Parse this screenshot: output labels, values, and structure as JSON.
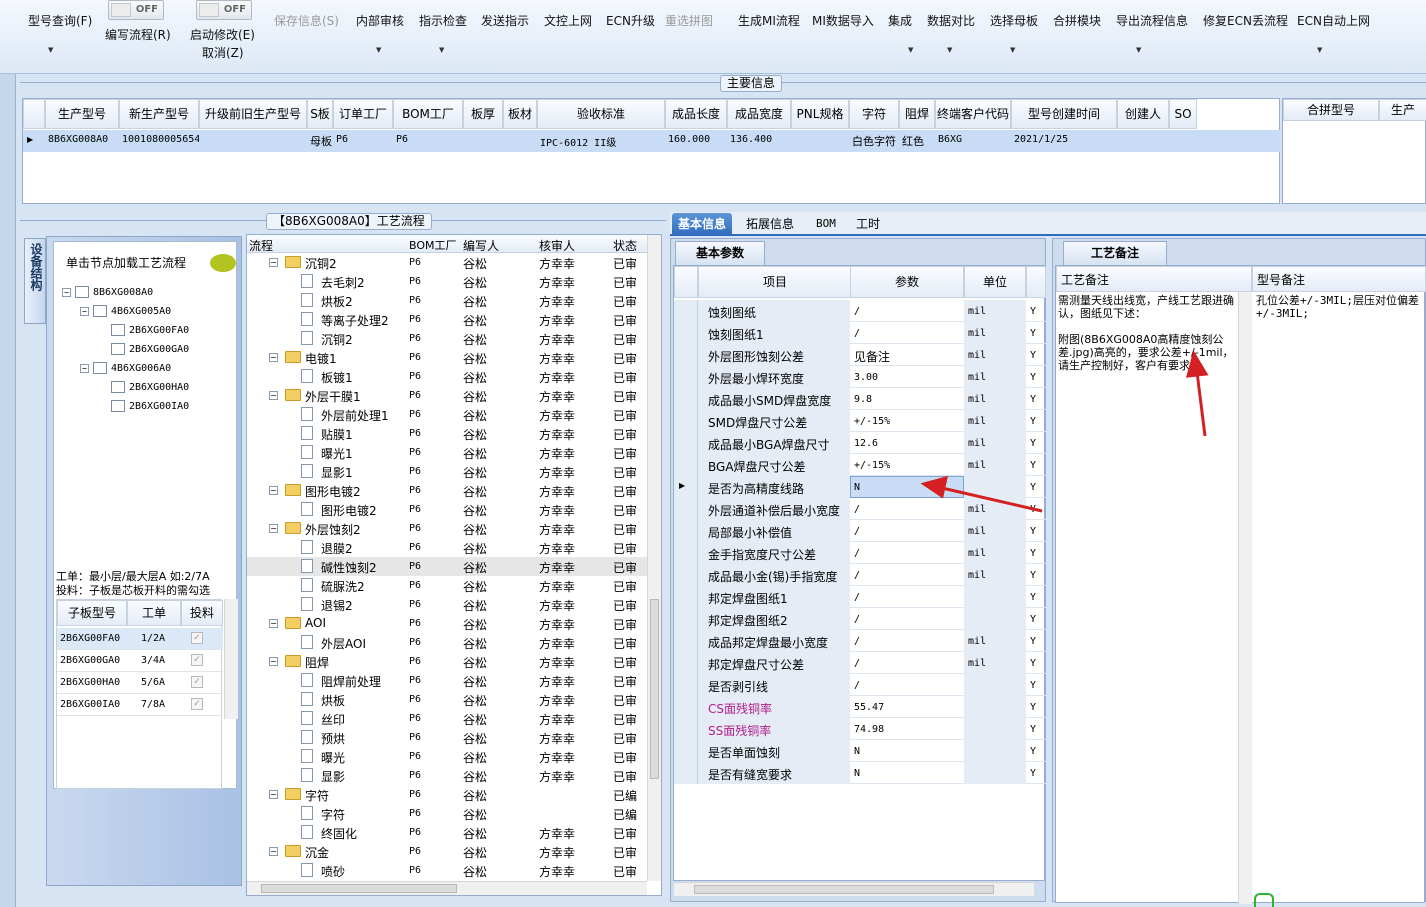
{
  "toolbar": {
    "items": [
      {
        "label": "型号查询(F)",
        "disabled": false
      },
      {
        "label": "编写流程(R)",
        "disabled": false
      },
      {
        "label": "启动修改(E)",
        "disabled": false
      },
      {
        "label": "取消(Z)",
        "disabled": false
      },
      {
        "label": "保存信息(S)",
        "disabled": true
      },
      {
        "label": "内部审核",
        "disabled": false
      },
      {
        "label": "指示检查",
        "disabled": false
      },
      {
        "label": "发送指示",
        "disabled": false
      },
      {
        "label": "文控上网",
        "disabled": false
      },
      {
        "label": "ECN升级",
        "disabled": false
      },
      {
        "label": "重选拼图",
        "disabled": true
      },
      {
        "label": "生成MI流程",
        "disabled": false
      },
      {
        "label": "MI数据导入",
        "disabled": false
      },
      {
        "label": "集成",
        "disabled": false
      },
      {
        "label": "数据对比",
        "disabled": false
      },
      {
        "label": "选择母板",
        "disabled": false
      },
      {
        "label": "合拼模块",
        "disabled": false
      },
      {
        "label": "导出流程信息",
        "disabled": false
      },
      {
        "label": "修复ECN丢流程",
        "disabled": false
      },
      {
        "label": "ECN自动上网",
        "disabled": false
      }
    ],
    "toggle1": "OFF",
    "toggle2": "OFF"
  },
  "main_info": {
    "caption": "主要信息",
    "columns": [
      "生产型号",
      "新生产型号",
      "升级前旧生产型号",
      "S板",
      "订单工厂",
      "BOM工厂",
      "板厚",
      "板材",
      "验收标准",
      "成品长度",
      "成品宽度",
      "PNL规格",
      "字符",
      "阻焊",
      "终端客户代码",
      "型号创建时间",
      "创建人",
      "SO"
    ],
    "row": [
      "8B6XG008A0",
      "10010800056541",
      "",
      "母板",
      "P6",
      "P6",
      "",
      "",
      "IPC-6012 II级",
      "160.000",
      "136.400",
      "",
      "白色字符",
      "红色",
      "B6XG",
      "2021/1/25",
      "",
      ""
    ],
    "right_columns": [
      "合拼型号",
      "生产"
    ]
  },
  "flow_panel": {
    "caption": "【8B6XG008A0】工艺流程",
    "side_tab": "设备结构",
    "load_hint": "单击节点加载工艺流程",
    "tree": [
      {
        "label": "8B6XG008A0",
        "level": 0
      },
      {
        "label": "4B6XG005A0",
        "level": 1
      },
      {
        "label": "2B6XG00FA0",
        "level": 2
      },
      {
        "label": "2B6XG00GA0",
        "level": 2
      },
      {
        "label": "4B6XG006A0",
        "level": 1
      },
      {
        "label": "2B6XG00HA0",
        "level": 2
      },
      {
        "label": "2B6XG00IA0",
        "level": 2
      }
    ],
    "note1": "工单：最小层/最大层A 如:2/7A",
    "note2": "投料：子板是芯板开料的需勾选",
    "sub_columns": [
      "子板型号",
      "工单",
      "投料"
    ],
    "sub_rows": [
      {
        "model": "2B6XG00FA0",
        "order": "1/2A"
      },
      {
        "model": "2B6XG00GA0",
        "order": "3/4A"
      },
      {
        "model": "2B6XG00HA0",
        "order": "5/6A"
      },
      {
        "model": "2B6XG00IA0",
        "order": "7/8A"
      }
    ],
    "flow_columns": [
      "流程",
      "BOM工厂",
      "编写人",
      "核审人",
      "状态"
    ],
    "flow_rows": [
      {
        "name": "沉铜2",
        "kind": "folder",
        "bom": "P6",
        "writer": "谷松",
        "checker": "方幸幸",
        "status": "已审"
      },
      {
        "name": "去毛刺2",
        "kind": "doc",
        "bom": "P6",
        "writer": "谷松",
        "checker": "方幸幸",
        "status": "已审"
      },
      {
        "name": "烘板2",
        "kind": "doc",
        "bom": "P6",
        "writer": "谷松",
        "checker": "方幸幸",
        "status": "已审"
      },
      {
        "name": "等离子处理2",
        "kind": "doc",
        "bom": "P6",
        "writer": "谷松",
        "checker": "方幸幸",
        "status": "已审"
      },
      {
        "name": "沉铜2",
        "kind": "doc",
        "bom": "P6",
        "writer": "谷松",
        "checker": "方幸幸",
        "status": "已审"
      },
      {
        "name": "电镀1",
        "kind": "folder",
        "bom": "P6",
        "writer": "谷松",
        "checker": "方幸幸",
        "status": "已审"
      },
      {
        "name": "板镀1",
        "kind": "doc",
        "bom": "P6",
        "writer": "谷松",
        "checker": "方幸幸",
        "status": "已审"
      },
      {
        "name": "外层干膜1",
        "kind": "folder",
        "bom": "P6",
        "writer": "谷松",
        "checker": "方幸幸",
        "status": "已审"
      },
      {
        "name": "外层前处理1",
        "kind": "doc",
        "bom": "P6",
        "writer": "谷松",
        "checker": "方幸幸",
        "status": "已审"
      },
      {
        "name": "贴膜1",
        "kind": "doc",
        "bom": "P6",
        "writer": "谷松",
        "checker": "方幸幸",
        "status": "已审"
      },
      {
        "name": "曝光1",
        "kind": "doc",
        "bom": "P6",
        "writer": "谷松",
        "checker": "方幸幸",
        "status": "已审"
      },
      {
        "name": "显影1",
        "kind": "doc",
        "bom": "P6",
        "writer": "谷松",
        "checker": "方幸幸",
        "status": "已审"
      },
      {
        "name": "图形电镀2",
        "kind": "folder",
        "bom": "P6",
        "writer": "谷松",
        "checker": "方幸幸",
        "status": "已审"
      },
      {
        "name": "图形电镀2",
        "kind": "doc",
        "bom": "P6",
        "writer": "谷松",
        "checker": "方幸幸",
        "status": "已审"
      },
      {
        "name": "外层蚀刻2",
        "kind": "folder",
        "bom": "P6",
        "writer": "谷松",
        "checker": "方幸幸",
        "status": "已审"
      },
      {
        "name": "退膜2",
        "kind": "doc",
        "bom": "P6",
        "writer": "谷松",
        "checker": "方幸幸",
        "status": "已审"
      },
      {
        "name": "碱性蚀刻2",
        "kind": "doc",
        "bom": "P6",
        "writer": "谷松",
        "checker": "方幸幸",
        "status": "已审"
      },
      {
        "name": "硫脲洗2",
        "kind": "doc",
        "bom": "P6",
        "writer": "谷松",
        "checker": "方幸幸",
        "status": "已审"
      },
      {
        "name": "退锡2",
        "kind": "doc",
        "bom": "P6",
        "writer": "谷松",
        "checker": "方幸幸",
        "status": "已审"
      },
      {
        "name": "AOI",
        "kind": "folder",
        "bom": "P6",
        "writer": "谷松",
        "checker": "方幸幸",
        "status": "已审"
      },
      {
        "name": "外层AOI",
        "kind": "doc",
        "bom": "P6",
        "writer": "谷松",
        "checker": "方幸幸",
        "status": "已审"
      },
      {
        "name": "阻焊",
        "kind": "folder",
        "bom": "P6",
        "writer": "谷松",
        "checker": "方幸幸",
        "status": "已审"
      },
      {
        "name": "阻焊前处理",
        "kind": "doc",
        "bom": "P6",
        "writer": "谷松",
        "checker": "方幸幸",
        "status": "已审"
      },
      {
        "name": "烘板",
        "kind": "doc",
        "bom": "P6",
        "writer": "谷松",
        "checker": "方幸幸",
        "status": "已审"
      },
      {
        "name": "丝印",
        "kind": "doc",
        "bom": "P6",
        "writer": "谷松",
        "checker": "方幸幸",
        "status": "已审"
      },
      {
        "name": "预烘",
        "kind": "doc",
        "bom": "P6",
        "writer": "谷松",
        "checker": "方幸幸",
        "status": "已审"
      },
      {
        "name": "曝光",
        "kind": "doc",
        "bom": "P6",
        "writer": "谷松",
        "checker": "方幸幸",
        "status": "已审"
      },
      {
        "name": "显影",
        "kind": "doc",
        "bom": "P6",
        "writer": "谷松",
        "checker": "方幸幸",
        "status": "已审"
      },
      {
        "name": "字符",
        "kind": "folder",
        "bom": "P6",
        "writer": "谷松",
        "checker": "",
        "status": "已编"
      },
      {
        "name": "字符",
        "kind": "doc",
        "bom": "P6",
        "writer": "谷松",
        "checker": "",
        "status": "已编"
      },
      {
        "name": "终固化",
        "kind": "doc",
        "bom": "P6",
        "writer": "谷松",
        "checker": "方幸幸",
        "status": "已审"
      },
      {
        "name": "沉金",
        "kind": "folder",
        "bom": "P6",
        "writer": "谷松",
        "checker": "方幸幸",
        "status": "已审"
      },
      {
        "name": "喷砂",
        "kind": "doc",
        "bom": "P6",
        "writer": "谷松",
        "checker": "方幸幸",
        "status": "已审"
      }
    ]
  },
  "info_tabs": [
    "基本信息",
    "拓展信息",
    "BOM",
    "工时"
  ],
  "params": {
    "tab": "基本参数",
    "columns": [
      "项目",
      "参数",
      "单位"
    ],
    "rows": [
      {
        "item": "蚀刻图纸",
        "value": "/",
        "unit": "mil",
        "flag": "Y"
      },
      {
        "item": "蚀刻图纸1",
        "value": "/",
        "unit": "mil",
        "flag": "Y"
      },
      {
        "item": "外层图形蚀刻公差",
        "value": "见备注",
        "unit": "mil",
        "flag": "Y"
      },
      {
        "item": "外层最小焊环宽度",
        "value": "3.00",
        "unit": "mil",
        "flag": "Y"
      },
      {
        "item": "成品最小SMD焊盘宽度",
        "value": "9.8",
        "unit": "mil",
        "flag": "Y"
      },
      {
        "item": "SMD焊盘尺寸公差",
        "value": "+/-15%",
        "unit": "mil",
        "flag": "Y"
      },
      {
        "item": "成品最小BGA焊盘尺寸",
        "value": "12.6",
        "unit": "mil",
        "flag": "Y"
      },
      {
        "item": "BGA焊盘尺寸公差",
        "value": "+/-15%",
        "unit": "mil",
        "flag": "Y"
      },
      {
        "item": "是否为高精度线路",
        "value": "N",
        "unit": "",
        "flag": "Y"
      },
      {
        "item": "外层通道补偿后最小宽度",
        "value": "/",
        "unit": "mil",
        "flag": "Y"
      },
      {
        "item": "局部最小补偿值",
        "value": "/",
        "unit": "mil",
        "flag": "Y"
      },
      {
        "item": "金手指宽度尺寸公差",
        "value": "/",
        "unit": "mil",
        "flag": "Y"
      },
      {
        "item": "成品最小金(锡)手指宽度",
        "value": "/",
        "unit": "mil",
        "flag": "Y"
      },
      {
        "item": "邦定焊盘图纸1",
        "value": "/",
        "unit": "",
        "flag": "Y"
      },
      {
        "item": "邦定焊盘图纸2",
        "value": "/",
        "unit": "",
        "flag": "Y"
      },
      {
        "item": "成品邦定焊盘最小宽度",
        "value": "/",
        "unit": "mil",
        "flag": "Y"
      },
      {
        "item": "邦定焊盘尺寸公差",
        "value": "/",
        "unit": "mil",
        "flag": "Y"
      },
      {
        "item": "是否剥引线",
        "value": "/",
        "unit": "",
        "flag": "Y"
      },
      {
        "item": "CS面残铜率",
        "value": "55.47",
        "unit": "",
        "flag": "Y"
      },
      {
        "item": "SS面残铜率",
        "value": "74.98",
        "unit": "",
        "flag": "Y"
      },
      {
        "item": "是否单面蚀刻",
        "value": "N",
        "unit": "",
        "flag": "Y"
      },
      {
        "item": "是否有缝宽要求",
        "value": "N",
        "unit": "",
        "flag": "Y"
      }
    ]
  },
  "remarks": {
    "tab": "工艺备注",
    "col1": "工艺备注",
    "col2": "型号备注",
    "process_note": "需测量天线出线宽，产线工艺跟进确认，图纸见下述：\n\n附图(8B6XG008A0高精度蚀刻公差.jpg)高亮的，要求公差+/-1mil，请生产控制好，客户有要求；",
    "model_note": "孔位公差+/-3MIL;层压对位偏差+/-3MIL;"
  },
  "colors": {
    "accent": "#2f6cbb",
    "arrow": "#d42020",
    "magenta": "#b0208a"
  }
}
